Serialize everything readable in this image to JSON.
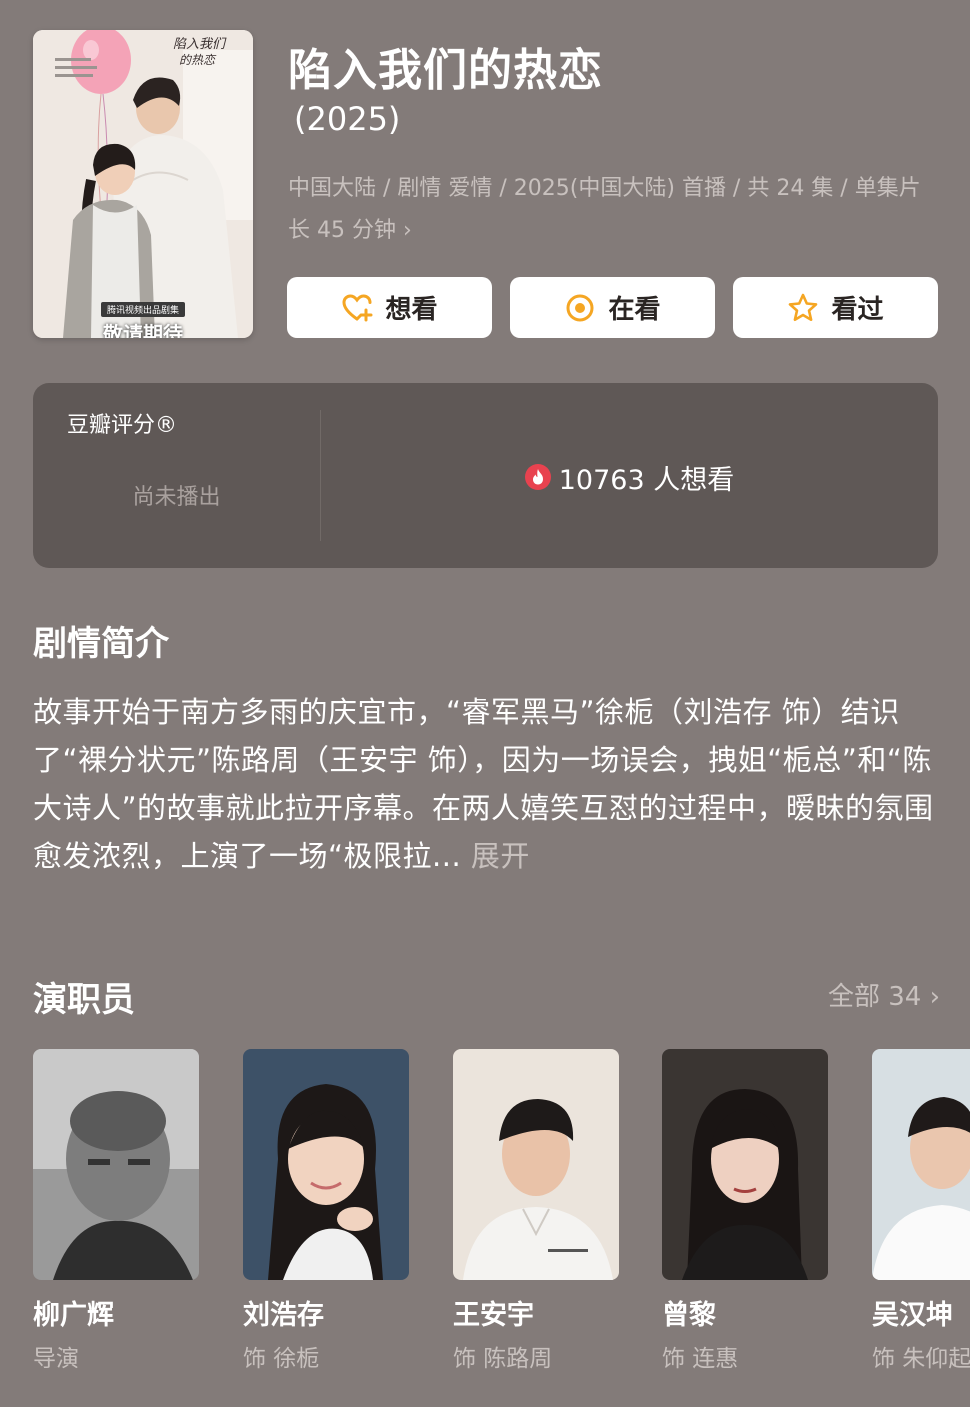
{
  "header": {
    "title": "陷入我们的热恋",
    "year": "(2025)",
    "meta": "中国大陆 / 剧情 爱情 / 2025(中国大陆) 首播 / 共 24 集 / 单集片长 45 分钟",
    "meta_chevron": "›",
    "poster": {
      "title_art": "陷入我们的热恋",
      "caption_small": "腾讯视频出品剧集",
      "caption_big": "敬请期待"
    }
  },
  "actions": [
    {
      "label": "想看",
      "icon": "heart-plus-icon",
      "color": "#f5a623"
    },
    {
      "label": "在看",
      "icon": "target-circle-icon",
      "color": "#f5a623"
    },
    {
      "label": "看过",
      "icon": "star-icon",
      "color": "#f5a623"
    }
  ],
  "rating": {
    "label": "豆瓣评分®",
    "status": "尚未播出",
    "want_count": "10763 人想看",
    "fire_icon": "fire-icon",
    "fire_color": "#e8424f"
  },
  "synopsis": {
    "title": "剧情简介",
    "text": "故事开始于南方多雨的庆宜市，“睿军黑马”徐栀（刘浩存 饰）结识了“裸分状元”陈路周（王安宇 饰），因为一场误会，拽姐“栀总”和“陈大诗人”的故事就此拉开序幕。在两人嬉笑互怼的过程中，暧昧的氛围愈发浓烈，上演了一场“极限拉... ",
    "expand": "展开"
  },
  "cast": {
    "title": "演职员",
    "all_label": "全部 34",
    "all_chevron": "›",
    "members": [
      {
        "name": "柳广辉",
        "role": "导演"
      },
      {
        "name": "刘浩存",
        "role": "饰 徐栀"
      },
      {
        "name": "王安宇",
        "role": "饰 陈路周"
      },
      {
        "name": "曾黎",
        "role": "饰 连惠"
      },
      {
        "name": "吴汉坤",
        "role": "饰 朱仰起"
      }
    ]
  },
  "colors": {
    "background": "#837b79",
    "card": "#5f5856",
    "muted_text": "#c8c1be",
    "accent": "#f5a623"
  }
}
